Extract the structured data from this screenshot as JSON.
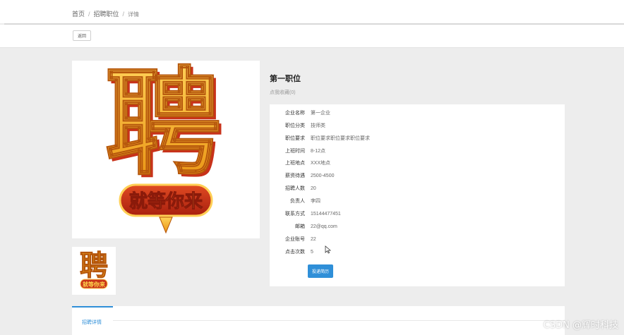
{
  "breadcrumb": {
    "home": "首页",
    "list": "招聘职位",
    "current": "详情"
  },
  "toolbar": {
    "back_label": "返回"
  },
  "job": {
    "title": "第一职位",
    "favorite_label": "点我收藏(0)",
    "image_text": "就等你来",
    "image_glyph": "聘",
    "fields": [
      {
        "label": "企业名称",
        "value": "第一企业"
      },
      {
        "label": "职位分类",
        "value": "技师类"
      },
      {
        "label": "职位要求",
        "value": "职位要求职位要求职位要求"
      },
      {
        "label": "上班时间",
        "value": "8-12点"
      },
      {
        "label": "上班地点",
        "value": "XXX地点"
      },
      {
        "label": "薪资待遇",
        "value": "2500-4500"
      },
      {
        "label": "招聘人数",
        "value": "20"
      },
      {
        "label": "负责人",
        "value": "李四"
      },
      {
        "label": "联系方式",
        "value": "15144477451"
      },
      {
        "label": "邮箱",
        "value": "22@qq.com"
      },
      {
        "label": "企业账号",
        "value": "22"
      },
      {
        "label": "点击次数",
        "value": "5"
      }
    ],
    "apply_label": "投递简历"
  },
  "tabs": {
    "detail_label": "招聘详情"
  },
  "watermark": "CSDN @辉时科技",
  "colors": {
    "accent": "#2f8fd8",
    "poster_gold": "#f2a81d",
    "poster_red": "#c8321a"
  }
}
